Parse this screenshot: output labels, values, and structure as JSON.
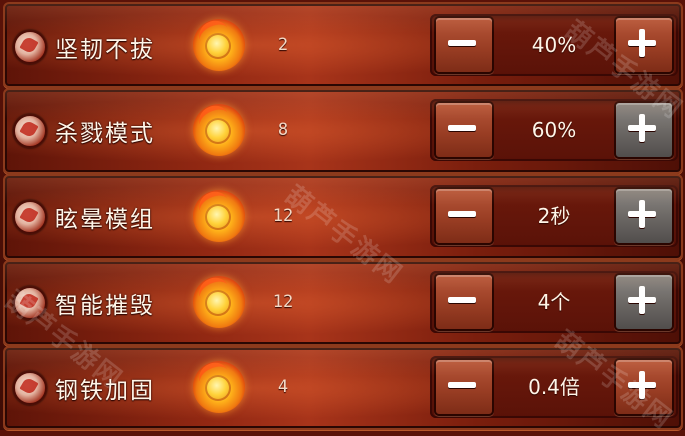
{
  "skills": [
    {
      "name": "坚韧不拔",
      "cost": "2",
      "value": "40%",
      "plus_state": "active"
    },
    {
      "name": "杀戮模式",
      "cost": "8",
      "value": "60%",
      "plus_state": "disabled"
    },
    {
      "name": "眩晕模组",
      "cost": "12",
      "value": "2秒",
      "plus_state": "disabled"
    },
    {
      "name": "智能摧毁",
      "cost": "12",
      "value": "4个",
      "plus_state": "disabled"
    },
    {
      "name": "钢铁加固",
      "cost": "4",
      "value": "0.4倍",
      "plus_state": "active"
    }
  ],
  "watermark": "葫芦手游网",
  "colors": {
    "panel": "#a8341a",
    "minus_button": "#9a3e24",
    "plus_button_active": "#9a3e24",
    "plus_button_disabled": "#6a6663",
    "text": "#fff5e8"
  },
  "icons": {
    "skill_icon": "skill-emblem-icon",
    "cost": "flame-coin-icon",
    "decrease": "minus-icon",
    "increase": "plus-icon"
  }
}
